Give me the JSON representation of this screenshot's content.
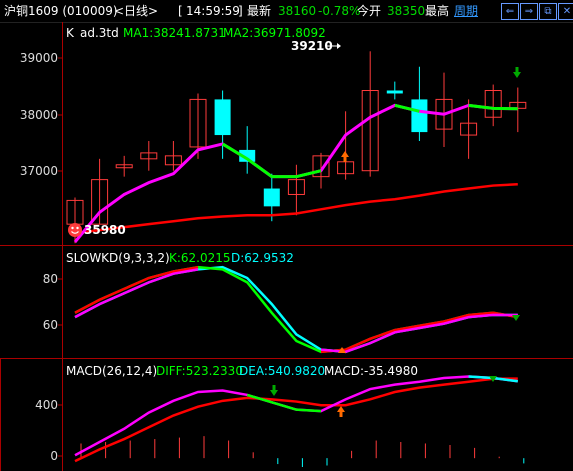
{
  "header": {
    "title": "沪铜1609 (010009)",
    "period_label": "<日线>",
    "time": "14:59:59",
    "latest_label": "最新",
    "latest": "38160",
    "change_pct": "-0.78%",
    "open_label": "今开",
    "open": "38350",
    "high_label": "最高",
    "period_link": "周期",
    "buttons": [
      {
        "name": "left-arrow-button",
        "glyph": "⇐"
      },
      {
        "name": "right-arrow-button",
        "glyph": "⇒"
      },
      {
        "name": "restore-button",
        "glyph": "⧉"
      },
      {
        "name": "close-button",
        "glyph": "✕"
      }
    ]
  },
  "panels": {
    "main": {
      "legend_k": "K",
      "legend_name": "ad.3td",
      "legend_ma1": "MA1:38241.8731",
      "legend_ma2": "MA2:36971.8092",
      "y_ticks": [
        "39000",
        "38000",
        "37000"
      ],
      "high_label": "39210",
      "low_label": "35980"
    },
    "kd": {
      "legend_name": "SLOWKD(9,3,3,2)",
      "legend_k": "K:62.0215",
      "legend_d": "D:62.9532",
      "y_ticks": [
        "80",
        "60"
      ]
    },
    "macd": {
      "legend_name": "MACD(26,12,4)",
      "legend_diff": "DIFF:523.2330",
      "legend_dea": "DEA:540.9820",
      "legend_macd": "MACD:-35.4980",
      "y_ticks": [
        "400",
        "0"
      ]
    }
  },
  "colors": {
    "up": "#ff3b3b",
    "down": "#00ffff",
    "ma_fast": "#ff00ff",
    "ma_slow": "#ff0000",
    "green_line": "#00ff00",
    "axis": "#aa0000",
    "tick_text": "#dddddd"
  },
  "chart_data": [
    {
      "type": "candlestick",
      "title": "ad.3td",
      "x": [
        1,
        2,
        3,
        4,
        5,
        6,
        7,
        8,
        9,
        10,
        11,
        12,
        13,
        14,
        15,
        16,
        17,
        18,
        19
      ],
      "open": [
        36300,
        36300,
        37250,
        37400,
        37300,
        37600,
        38400,
        37550,
        36900,
        36800,
        37100,
        37150,
        37200,
        38550,
        38400,
        37900,
        37800,
        38100,
        38250
      ],
      "close": [
        36700,
        37050,
        37300,
        37500,
        37450,
        38400,
        37800,
        37350,
        36600,
        37050,
        37450,
        37350,
        38550,
        38500,
        37850,
        38400,
        38000,
        38550,
        38350
      ],
      "high": [
        36750,
        37400,
        37450,
        37700,
        37700,
        38500,
        38550,
        37950,
        37150,
        37300,
        37500,
        38200,
        39210,
        38700,
        38950,
        38850,
        38400,
        38650,
        38600
      ],
      "low": [
        35980,
        36300,
        37100,
        37200,
        37200,
        37400,
        37400,
        37150,
        36350,
        36450,
        36900,
        37050,
        37100,
        38400,
        37700,
        37600,
        37400,
        37950,
        37850
      ],
      "ma1": [
        36000,
        36500,
        36800,
        37000,
        37150,
        37550,
        37650,
        37400,
        37100,
        37100,
        37200,
        37800,
        38100,
        38300,
        38200,
        38150,
        38300,
        38250,
        38241.87
      ],
      "ma2": [
        36150,
        36200,
        36250,
        36300,
        36350,
        36400,
        36430,
        36450,
        36450,
        36480,
        36550,
        36620,
        36680,
        36720,
        36780,
        36850,
        36900,
        36950,
        36971.81
      ],
      "ylim": [
        36000,
        39400
      ]
    },
    {
      "type": "line",
      "title": "SLOWKD(9,3,3,2)",
      "x": [
        1,
        2,
        3,
        4,
        5,
        6,
        7,
        8,
        9,
        10,
        11,
        12,
        13,
        14,
        15,
        16,
        17,
        18,
        19
      ],
      "series": [
        {
          "name": "K",
          "values": [
            64,
            70,
            75,
            80,
            83,
            85,
            84,
            78,
            64,
            51,
            46,
            47,
            52,
            56,
            58,
            60,
            63,
            64,
            62.02
          ]
        },
        {
          "name": "D",
          "values": [
            62,
            68,
            73,
            78,
            82,
            84,
            85,
            80,
            68,
            54,
            47,
            46,
            50,
            55,
            57,
            59,
            62,
            63,
            62.95
          ]
        }
      ],
      "ylim": [
        45,
        92
      ]
    },
    {
      "type": "bar",
      "title": "MACD(26,12,4)",
      "x": [
        1,
        2,
        3,
        4,
        5,
        6,
        7,
        8,
        9,
        10,
        11,
        12,
        13,
        14,
        15,
        16,
        17,
        18,
        19
      ],
      "series": [
        {
          "name": "DIFF",
          "values": [
            20,
            110,
            200,
            310,
            390,
            450,
            460,
            430,
            380,
            330,
            320,
            400,
            470,
            500,
            520,
            545,
            555,
            545,
            523.23
          ]
        },
        {
          "name": "DEA",
          "values": [
            -20,
            60,
            130,
            210,
            290,
            350,
            390,
            410,
            400,
            385,
            360,
            360,
            400,
            450,
            480,
            500,
            520,
            540,
            540.98
          ]
        },
        {
          "name": "MACD",
          "values": [
            100,
            110,
            120,
            130,
            140,
            150,
            120,
            40,
            -40,
            -60,
            -50,
            50,
            120,
            110,
            100,
            90,
            70,
            10,
            -35.5
          ]
        }
      ],
      "ylim": [
        -60,
        620
      ]
    }
  ]
}
